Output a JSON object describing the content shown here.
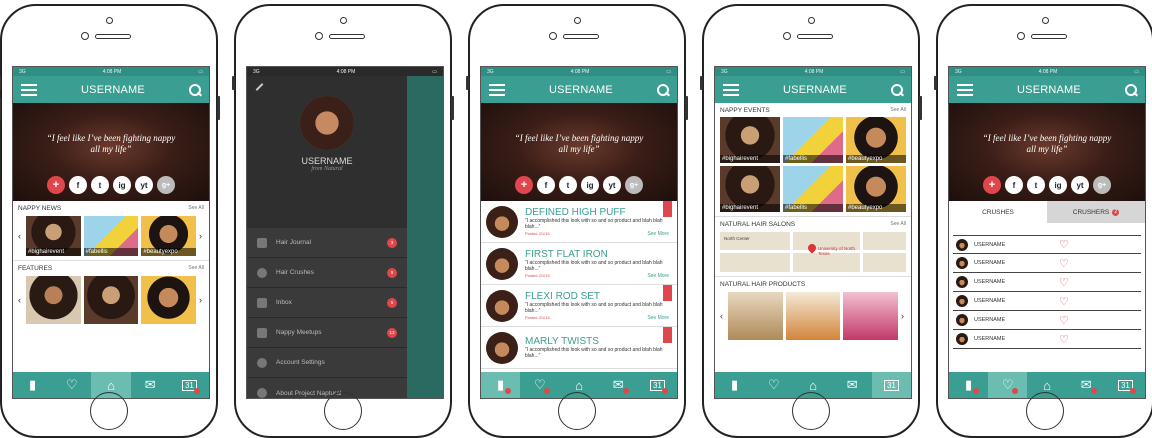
{
  "status": {
    "carrier": "3G",
    "time": "4:08 PM"
  },
  "username": "USERNAME",
  "hero": {
    "quote": "“I feel like I’ve been fighting nappy all my life”"
  },
  "social": [
    "+",
    "f",
    "t",
    "ig",
    "yt",
    "g+"
  ],
  "home": {
    "news_title": "NAPPY NEWS",
    "see_all": "See All",
    "news": [
      "#bighairevent",
      "#fabellis",
      "#beautyexpo"
    ],
    "features_title": "FEATURES"
  },
  "drawer": {
    "name": "USERNAME",
    "subtitle": "from Natural",
    "items": [
      {
        "label": "Hair Journal",
        "count": "3",
        "icon": "journal-icon"
      },
      {
        "label": "Hair Crushes",
        "count": "8",
        "icon": "heart-icon"
      },
      {
        "label": "Inbox",
        "count": "5",
        "icon": "mail-icon"
      },
      {
        "label": "Nappy Meetups",
        "count": "13",
        "icon": "calendar-icon"
      },
      {
        "label": "Account Settings",
        "count": "",
        "icon": "gear-icon"
      },
      {
        "label": "About Project Naptural",
        "count": "",
        "icon": "info-icon"
      }
    ]
  },
  "journal": {
    "entries": [
      {
        "title": "DEFINED HIGH PUFF",
        "desc": "“I accomplished this look with so and so product and blah blah blah...”",
        "posted": "Posted 2/1/15",
        "more": "See More"
      },
      {
        "title": "FIRST FLAT IRON",
        "desc": "“I accomplished this look with so and so product and blah blah blah...”",
        "posted": "Posted 2/1/15",
        "more": "See More"
      },
      {
        "title": "FLEXI ROD SET",
        "desc": "“I accomplished this look with so and so product and blah blah blah...”",
        "posted": "Posted 2/1/15",
        "more": "See More"
      },
      {
        "title": "MARLY TWISTS",
        "desc": "“I accomplished this look with so and so product and blah blah blah...”",
        "posted": "",
        "more": ""
      }
    ]
  },
  "events": {
    "events_title": "NAPPY EVENTS",
    "events": [
      "#bighairevent",
      "#fabellis",
      "#beautyexpo"
    ],
    "salons_title": "NATURAL HAIR SALONS",
    "map_label": "University of North Texas",
    "map_north": "North Center",
    "products_title": "NATURAL HAIR PRODUCTS"
  },
  "crushes": {
    "tab1": "CRUSHES",
    "tab2": "CRUSHERS",
    "badge": "2",
    "rows": [
      "USERNAME",
      "USERNAME",
      "USERNAME",
      "USERNAME",
      "USERNAME",
      "USERNAME"
    ]
  },
  "tabbar": {
    "calendar_day": "31"
  }
}
